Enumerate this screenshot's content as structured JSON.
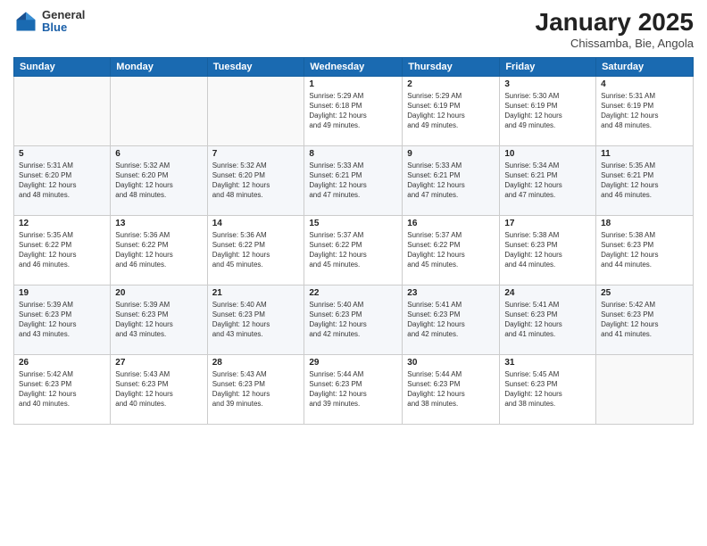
{
  "logo": {
    "general": "General",
    "blue": "Blue"
  },
  "header": {
    "title": "January 2025",
    "subtitle": "Chissamba, Bie, Angola"
  },
  "weekdays": [
    "Sunday",
    "Monday",
    "Tuesday",
    "Wednesday",
    "Thursday",
    "Friday",
    "Saturday"
  ],
  "weeks": [
    [
      {
        "day": "",
        "info": ""
      },
      {
        "day": "",
        "info": ""
      },
      {
        "day": "",
        "info": ""
      },
      {
        "day": "1",
        "info": "Sunrise: 5:29 AM\nSunset: 6:18 PM\nDaylight: 12 hours\nand 49 minutes."
      },
      {
        "day": "2",
        "info": "Sunrise: 5:29 AM\nSunset: 6:19 PM\nDaylight: 12 hours\nand 49 minutes."
      },
      {
        "day": "3",
        "info": "Sunrise: 5:30 AM\nSunset: 6:19 PM\nDaylight: 12 hours\nand 49 minutes."
      },
      {
        "day": "4",
        "info": "Sunrise: 5:31 AM\nSunset: 6:19 PM\nDaylight: 12 hours\nand 48 minutes."
      }
    ],
    [
      {
        "day": "5",
        "info": "Sunrise: 5:31 AM\nSunset: 6:20 PM\nDaylight: 12 hours\nand 48 minutes."
      },
      {
        "day": "6",
        "info": "Sunrise: 5:32 AM\nSunset: 6:20 PM\nDaylight: 12 hours\nand 48 minutes."
      },
      {
        "day": "7",
        "info": "Sunrise: 5:32 AM\nSunset: 6:20 PM\nDaylight: 12 hours\nand 48 minutes."
      },
      {
        "day": "8",
        "info": "Sunrise: 5:33 AM\nSunset: 6:21 PM\nDaylight: 12 hours\nand 47 minutes."
      },
      {
        "day": "9",
        "info": "Sunrise: 5:33 AM\nSunset: 6:21 PM\nDaylight: 12 hours\nand 47 minutes."
      },
      {
        "day": "10",
        "info": "Sunrise: 5:34 AM\nSunset: 6:21 PM\nDaylight: 12 hours\nand 47 minutes."
      },
      {
        "day": "11",
        "info": "Sunrise: 5:35 AM\nSunset: 6:21 PM\nDaylight: 12 hours\nand 46 minutes."
      }
    ],
    [
      {
        "day": "12",
        "info": "Sunrise: 5:35 AM\nSunset: 6:22 PM\nDaylight: 12 hours\nand 46 minutes."
      },
      {
        "day": "13",
        "info": "Sunrise: 5:36 AM\nSunset: 6:22 PM\nDaylight: 12 hours\nand 46 minutes."
      },
      {
        "day": "14",
        "info": "Sunrise: 5:36 AM\nSunset: 6:22 PM\nDaylight: 12 hours\nand 45 minutes."
      },
      {
        "day": "15",
        "info": "Sunrise: 5:37 AM\nSunset: 6:22 PM\nDaylight: 12 hours\nand 45 minutes."
      },
      {
        "day": "16",
        "info": "Sunrise: 5:37 AM\nSunset: 6:22 PM\nDaylight: 12 hours\nand 45 minutes."
      },
      {
        "day": "17",
        "info": "Sunrise: 5:38 AM\nSunset: 6:23 PM\nDaylight: 12 hours\nand 44 minutes."
      },
      {
        "day": "18",
        "info": "Sunrise: 5:38 AM\nSunset: 6:23 PM\nDaylight: 12 hours\nand 44 minutes."
      }
    ],
    [
      {
        "day": "19",
        "info": "Sunrise: 5:39 AM\nSunset: 6:23 PM\nDaylight: 12 hours\nand 43 minutes."
      },
      {
        "day": "20",
        "info": "Sunrise: 5:39 AM\nSunset: 6:23 PM\nDaylight: 12 hours\nand 43 minutes."
      },
      {
        "day": "21",
        "info": "Sunrise: 5:40 AM\nSunset: 6:23 PM\nDaylight: 12 hours\nand 43 minutes."
      },
      {
        "day": "22",
        "info": "Sunrise: 5:40 AM\nSunset: 6:23 PM\nDaylight: 12 hours\nand 42 minutes."
      },
      {
        "day": "23",
        "info": "Sunrise: 5:41 AM\nSunset: 6:23 PM\nDaylight: 12 hours\nand 42 minutes."
      },
      {
        "day": "24",
        "info": "Sunrise: 5:41 AM\nSunset: 6:23 PM\nDaylight: 12 hours\nand 41 minutes."
      },
      {
        "day": "25",
        "info": "Sunrise: 5:42 AM\nSunset: 6:23 PM\nDaylight: 12 hours\nand 41 minutes."
      }
    ],
    [
      {
        "day": "26",
        "info": "Sunrise: 5:42 AM\nSunset: 6:23 PM\nDaylight: 12 hours\nand 40 minutes."
      },
      {
        "day": "27",
        "info": "Sunrise: 5:43 AM\nSunset: 6:23 PM\nDaylight: 12 hours\nand 40 minutes."
      },
      {
        "day": "28",
        "info": "Sunrise: 5:43 AM\nSunset: 6:23 PM\nDaylight: 12 hours\nand 39 minutes."
      },
      {
        "day": "29",
        "info": "Sunrise: 5:44 AM\nSunset: 6:23 PM\nDaylight: 12 hours\nand 39 minutes."
      },
      {
        "day": "30",
        "info": "Sunrise: 5:44 AM\nSunset: 6:23 PM\nDaylight: 12 hours\nand 38 minutes."
      },
      {
        "day": "31",
        "info": "Sunrise: 5:45 AM\nSunset: 6:23 PM\nDaylight: 12 hours\nand 38 minutes."
      },
      {
        "day": "",
        "info": ""
      }
    ]
  ]
}
